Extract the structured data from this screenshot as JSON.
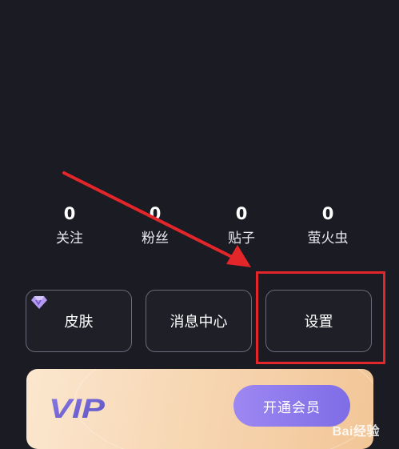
{
  "stats": [
    {
      "value": "0",
      "label": "关注"
    },
    {
      "value": "0",
      "label": "粉丝"
    },
    {
      "value": "0",
      "label": "贴子"
    },
    {
      "value": "0",
      "label": "萤火虫"
    }
  ],
  "actions": {
    "skin": "皮肤",
    "messages": "消息中心",
    "settings": "设置"
  },
  "vip": {
    "logo_text": "VIP",
    "button_label": "开通会员"
  },
  "watermark": "Bai经验",
  "colors": {
    "background": "#1b1b23",
    "highlight": "#e3262a",
    "vip_button": "#8f7aee"
  }
}
